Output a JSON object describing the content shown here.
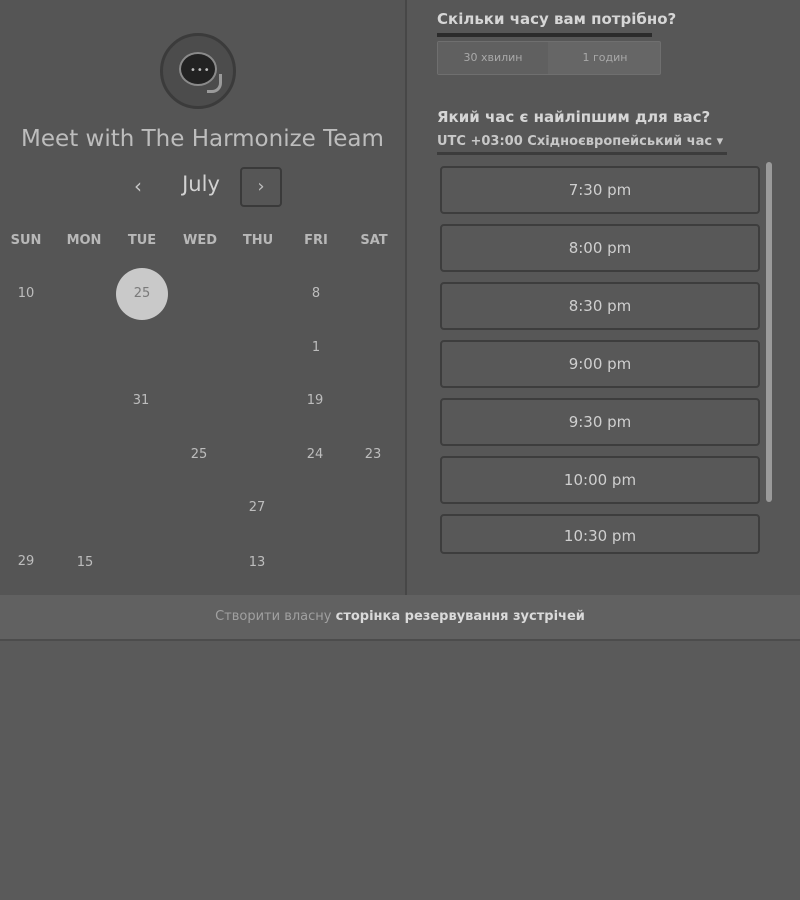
{
  "calendar": {
    "title": "Meet with The Harmonize Team",
    "month": "July",
    "prev_icon": "‹",
    "next_icon": "›",
    "weekdays": [
      "SUN",
      "MON",
      "TUE",
      "WED",
      "THU",
      "FRI",
      "SAT"
    ],
    "days": {
      "r1_sun": "10",
      "r1_tue": "25",
      "r1_fri": "8",
      "r2_fri": "1",
      "r3_tue": "31",
      "r3_fri": "19",
      "r4_wed": "25",
      "r4_fri": "24",
      "r4_sat": "23",
      "r5_thu": "27",
      "r6_sun": "29",
      "r6_mon": "15",
      "r6_thu": "13"
    }
  },
  "booking": {
    "duration_question": "Скільки часу вам потрібно?",
    "duration_options": [
      "30 хвилин",
      "1 годин"
    ],
    "time_question": "Який час є найліпшим для вас?",
    "timezone": "UTC +03:00 Східноєвропейський час",
    "timezone_caret": "▾",
    "slots": [
      "7:30 pm",
      "8:00 pm",
      "8:30 pm",
      "9:00 pm",
      "9:30 pm",
      "10:00 pm",
      "10:30 pm"
    ]
  },
  "footer": {
    "prefix": "Створити власну ",
    "link": "сторінка резервування зустрічей"
  }
}
